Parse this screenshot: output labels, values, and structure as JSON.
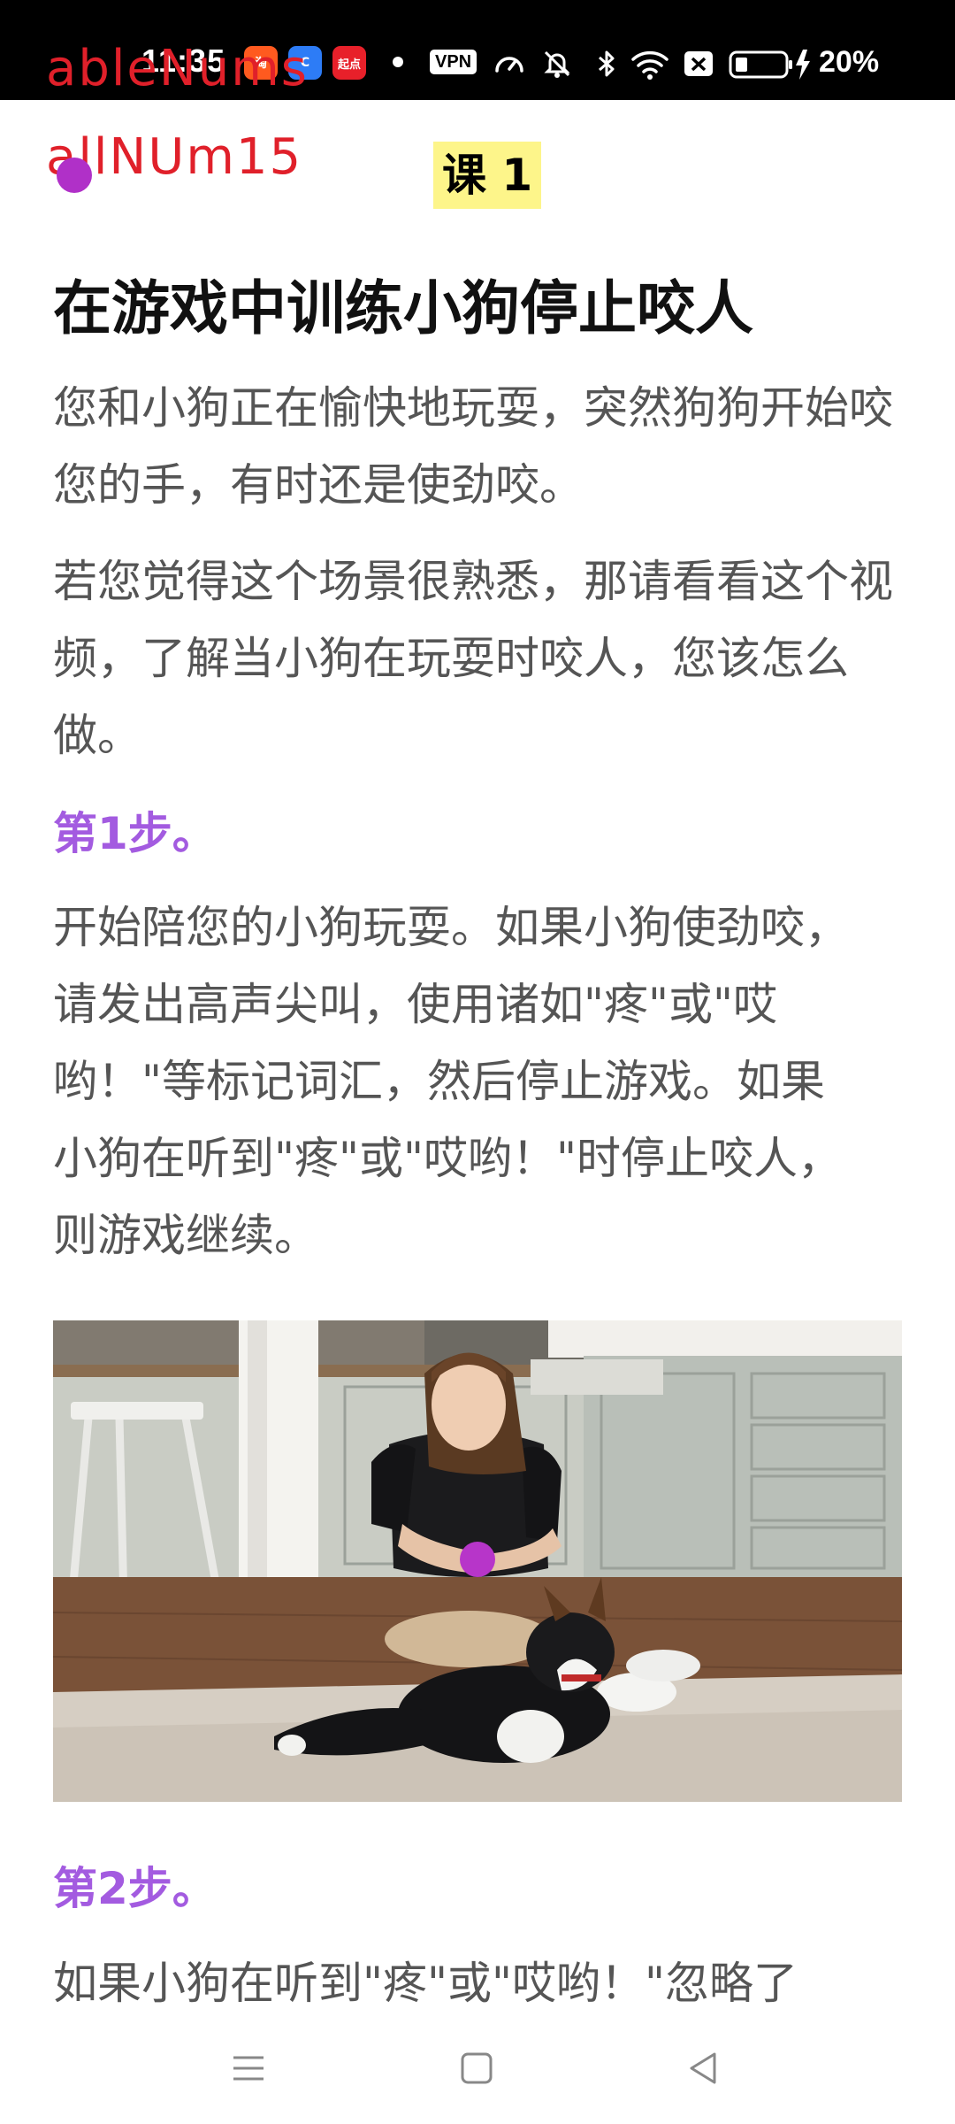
{
  "status_bar": {
    "time": "11:35",
    "apps": [
      {
        "name": "taobao-icon",
        "label": "淘",
        "color": "#ff5a1f"
      },
      {
        "name": "browser-icon",
        "label": "C",
        "color": "#2d7cf6"
      },
      {
        "name": "qidian-icon",
        "label": "起点",
        "color": "#e8202a"
      }
    ],
    "vpn_label": "VPN",
    "battery_percent": "20%"
  },
  "overlay": {
    "label1": "ableNums",
    "label2": "allNUm15"
  },
  "lesson": {
    "label": "课 1",
    "title": "在游戏中训练小狗停止咬人",
    "intro1": "您和小狗正在愉快地玩耍，突然狗狗开始咬您的手，有时还是使劲咬。",
    "intro2": "若您觉得这个场景很熟悉，那请看看这个视频，了解当小狗在玩耍时咬人，您该怎么做。",
    "step1_title": "第1步。",
    "step1_text": "开始陪您的小狗玩耍。如果小狗使劲咬，请发出高声尖叫，使用诸如\"疼\"或\"哎哟！\"等标记词汇，然后停止游戏。如果小狗在听到\"疼\"或\"哎哟！\"时停止咬人，则游戏继续。",
    "step2_title": "第2步。",
    "step2_text": "如果小狗在听到\"疼\"或\"哎哟！\"忽略了"
  },
  "nav": {
    "menu_icon": "menu-icon",
    "home_icon": "home-icon",
    "back_icon": "back-icon"
  }
}
